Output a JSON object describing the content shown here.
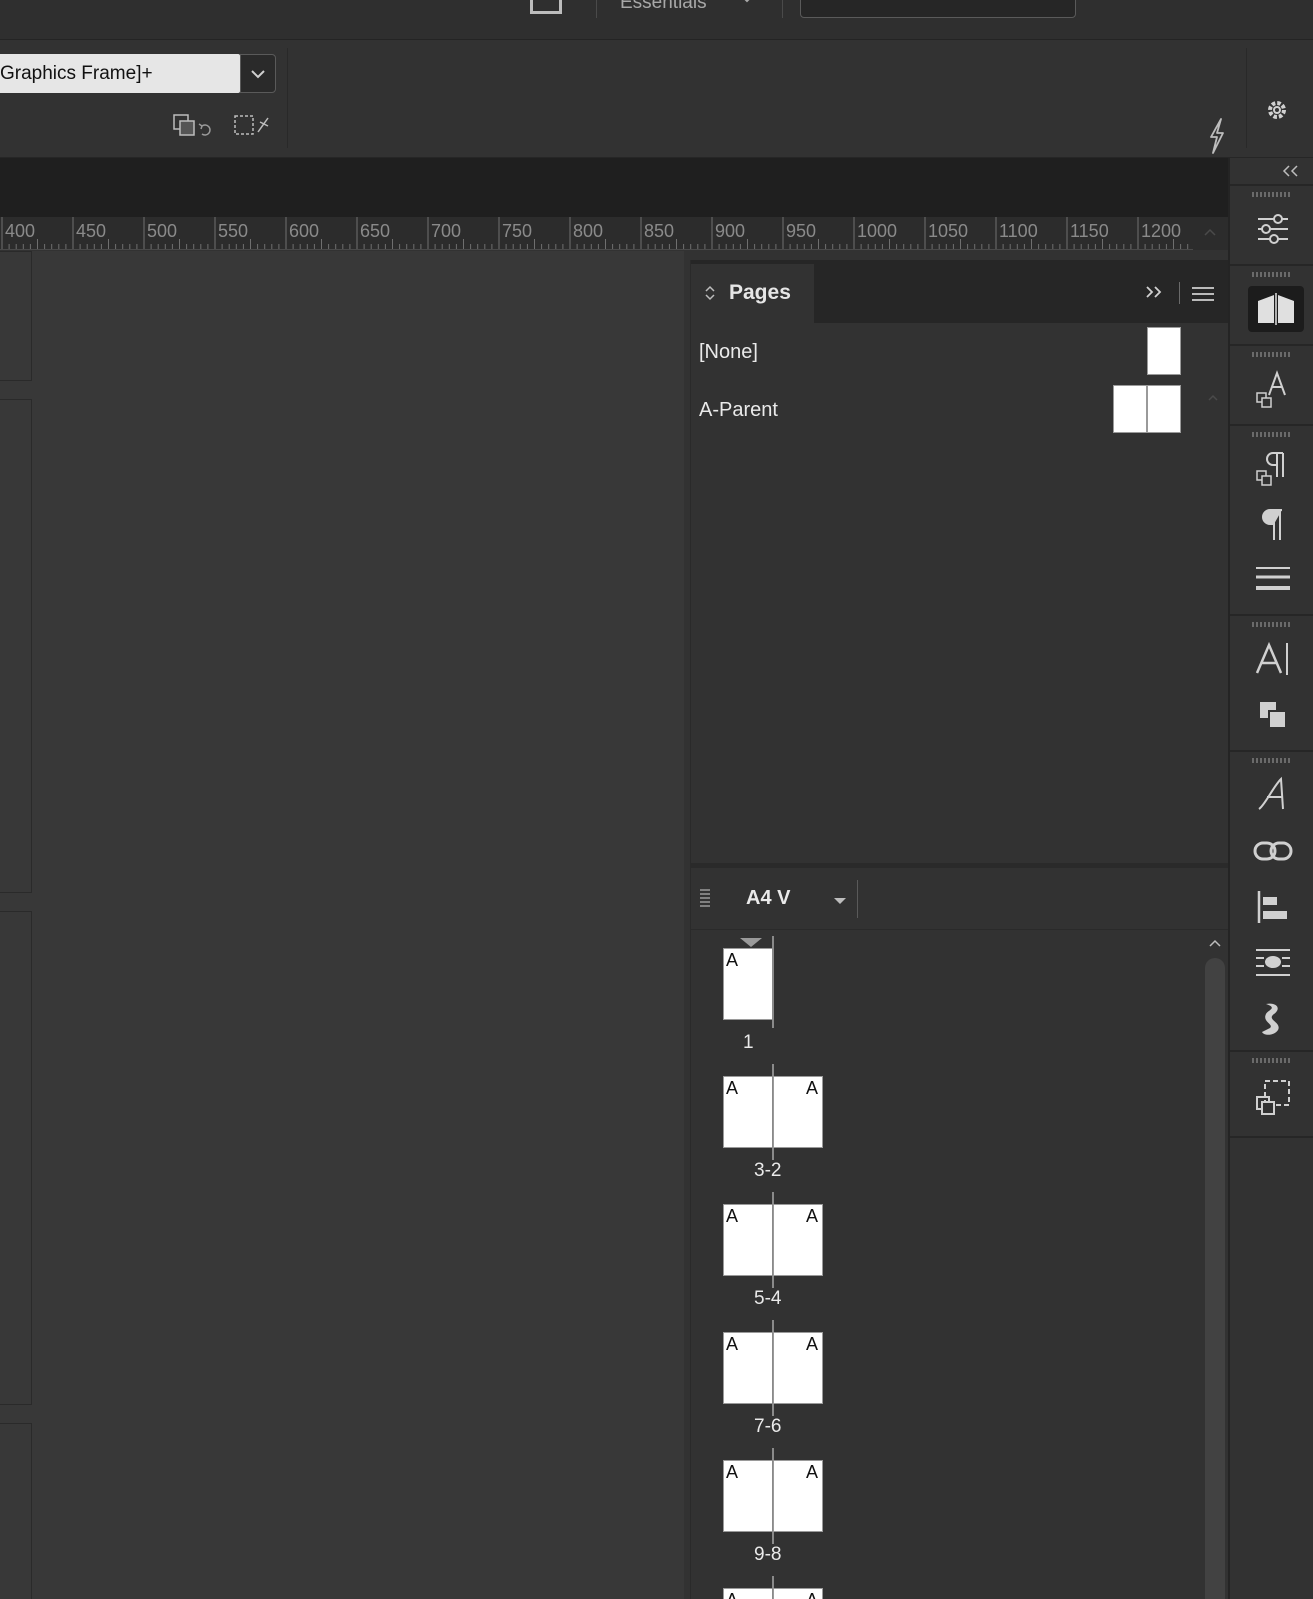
{
  "app_bar": {
    "workspace_label": "Essentials"
  },
  "control_bar": {
    "object_style_value": "Graphics Frame]+"
  },
  "ruler": {
    "tick_labels": [
      "400",
      "450",
      "500",
      "550",
      "600",
      "650",
      "700",
      "750",
      "800",
      "850",
      "900",
      "950",
      "1000",
      "1050",
      "1100",
      "1150",
      "1200"
    ]
  },
  "pages_panel": {
    "tab_label": "Pages",
    "parents": [
      {
        "label": "[None]",
        "pages": 1
      },
      {
        "label": "A-Parent",
        "pages": 2
      }
    ],
    "page_size_label": "A4 V",
    "spreads": [
      {
        "label": "1",
        "left": "A",
        "right": null
      },
      {
        "label": "3-2",
        "left": "A",
        "right": "A"
      },
      {
        "label": "5-4",
        "left": "A",
        "right": "A"
      },
      {
        "label": "7-6",
        "left": "A",
        "right": "A"
      },
      {
        "label": "9-8",
        "left": "A",
        "right": "A"
      },
      {
        "label": "",
        "left": "A",
        "right": "A"
      }
    ]
  },
  "dock": {
    "panels": [
      "properties-icon",
      "pages-icon",
      "character-styles-icon",
      "paragraph-styles-icon",
      "paragraph-icon",
      "stroke-icon",
      "character-icon",
      "object-styles-icon",
      "glyphs-icon",
      "links-icon",
      "align-icon",
      "text-wrap-icon",
      "swatches-icon",
      "layers-icon"
    ]
  },
  "colors": {
    "background": "#323232",
    "canvas": "#383838",
    "panel_tab_strip": "#262626",
    "page_thumb": "#ffffff"
  }
}
